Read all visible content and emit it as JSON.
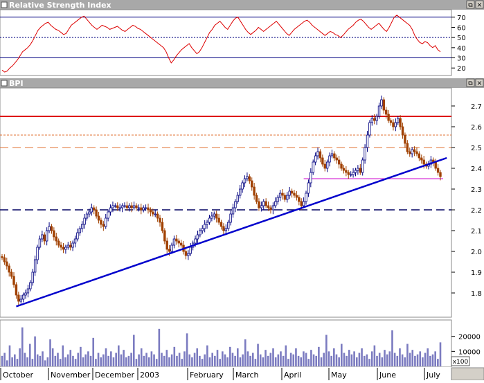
{
  "rsi_panel": {
    "title": "Relative Strength Index",
    "ticks": [
      70,
      60,
      50,
      40,
      30,
      20
    ],
    "levels": {
      "upper": 70,
      "mid": 50,
      "lower": 30
    },
    "ylim": [
      14,
      76
    ]
  },
  "price_panel": {
    "title": "BPI",
    "ticks": [
      2.7,
      2.6,
      2.5,
      2.4,
      2.3,
      2.2,
      2.1,
      2.0,
      1.9,
      1.8
    ],
    "tick_labels": [
      "2.7",
      "2.6",
      "2.5",
      "2.4",
      "2.3",
      "2.2",
      "2.1",
      "2.0",
      "1.9",
      "1.8"
    ],
    "ylim": [
      1.69,
      2.78
    ],
    "hlines": [
      {
        "name": "resistance-red",
        "value": 2.65,
        "color": "#dd0000",
        "style": "solid"
      },
      {
        "name": "fib-dotted",
        "value": 2.56,
        "color": "#e07030",
        "style": "dotted"
      },
      {
        "name": "fib-dashed",
        "value": 2.5,
        "color": "#e07030",
        "style": "dashed"
      },
      {
        "name": "support-magenta",
        "value": 2.35,
        "color": "#cc00cc",
        "style": "solid-short"
      },
      {
        "name": "support-navy-dashed",
        "value": 2.2,
        "color": "#000060",
        "style": "dashed"
      }
    ],
    "trendline": {
      "from": {
        "bar": 6,
        "value": 1.735
      },
      "to": {
        "bar": 184,
        "value": 2.45
      },
      "color": "#0000cc"
    }
  },
  "volume_panel": {
    "ticks": [
      20000,
      10000
    ],
    "ylim": [
      0,
      30000
    ],
    "multiplier_label": "x100"
  },
  "x_axis": {
    "labels": [
      "October",
      "November",
      "December",
      "2003",
      "February",
      "March",
      "April",
      "May",
      "June",
      "July"
    ]
  },
  "colors": {
    "up": "#000080",
    "down": "#a04000",
    "rsi": "#dd0000",
    "volume": "#7b7bc0",
    "header": "#999999"
  },
  "window_buttons": {
    "restore": "⧉",
    "close": "×"
  },
  "chart_data": {
    "type": "candlestick",
    "title": "BPI",
    "x_labels": [
      "October",
      "November",
      "December",
      "2003",
      "February",
      "March",
      "April",
      "May",
      "June",
      "July"
    ],
    "series": [
      {
        "name": "price_close",
        "values": [
          1.97,
          1.95,
          1.93,
          1.9,
          1.88,
          1.84,
          1.79,
          1.76,
          1.77,
          1.79,
          1.8,
          1.82,
          1.85,
          1.9,
          1.96,
          2.02,
          2.06,
          2.08,
          2.05,
          2.1,
          2.12,
          2.1,
          2.07,
          2.05,
          2.03,
          2.02,
          2.01,
          2.02,
          2.03,
          2.02,
          2.04,
          2.06,
          2.09,
          2.11,
          2.13,
          2.16,
          2.18,
          2.19,
          2.21,
          2.2,
          2.17,
          2.15,
          2.13,
          2.12,
          2.16,
          2.19,
          2.21,
          2.22,
          2.22,
          2.21,
          2.21,
          2.22,
          2.22,
          2.21,
          2.22,
          2.21,
          2.22,
          2.21,
          2.21,
          2.2,
          2.21,
          2.21,
          2.2,
          2.19,
          2.18,
          2.18,
          2.16,
          2.14,
          2.1,
          2.05,
          2.01,
          2.0,
          2.03,
          2.06,
          2.05,
          2.04,
          2.03,
          2.0,
          1.98,
          1.99,
          2.02,
          2.04,
          2.06,
          2.08,
          2.1,
          2.11,
          2.13,
          2.14,
          2.16,
          2.17,
          2.18,
          2.16,
          2.14,
          2.12,
          2.1,
          2.11,
          2.14,
          2.18,
          2.21,
          2.24,
          2.27,
          2.3,
          2.33,
          2.35,
          2.36,
          2.34,
          2.31,
          2.27,
          2.24,
          2.21,
          2.22,
          2.24,
          2.22,
          2.21,
          2.2,
          2.22,
          2.24,
          2.26,
          2.28,
          2.27,
          2.25,
          2.27,
          2.29,
          2.28,
          2.27,
          2.26,
          2.24,
          2.22,
          2.24,
          2.28,
          2.33,
          2.38,
          2.43,
          2.46,
          2.48,
          2.45,
          2.42,
          2.4,
          2.43,
          2.46,
          2.47,
          2.45,
          2.44,
          2.42,
          2.4,
          2.39,
          2.38,
          2.37,
          2.37,
          2.38,
          2.39,
          2.4,
          2.38,
          2.44,
          2.5,
          2.56,
          2.62,
          2.64,
          2.63,
          2.65,
          2.7,
          2.73,
          2.68,
          2.66,
          2.63,
          2.62,
          2.6,
          2.62,
          2.64,
          2.6,
          2.56,
          2.52,
          2.48,
          2.47,
          2.49,
          2.48,
          2.47,
          2.45,
          2.44,
          2.42,
          2.41,
          2.42,
          2.44,
          2.43,
          2.4,
          2.38,
          2.36
        ]
      },
      {
        "name": "rsi",
        "values": [
          18,
          16,
          17,
          20,
          22,
          25,
          28,
          32,
          36,
          38,
          40,
          43,
          47,
          52,
          57,
          60,
          62,
          64,
          65,
          62,
          60,
          58,
          57,
          55,
          53,
          54,
          58,
          62,
          64,
          66,
          68,
          70,
          71,
          68,
          65,
          62,
          60,
          58,
          60,
          62,
          61,
          60,
          58,
          59,
          60,
          61,
          59,
          57,
          56,
          58,
          60,
          62,
          61,
          59,
          58,
          56,
          54,
          52,
          50,
          48,
          46,
          44,
          42,
          40,
          36,
          30,
          25,
          28,
          32,
          35,
          38,
          40,
          42,
          44,
          40,
          37,
          34,
          36,
          40,
          45,
          50,
          55,
          58,
          62,
          64,
          66,
          63,
          60,
          58,
          62,
          66,
          69,
          70,
          66,
          62,
          58,
          55,
          53,
          55,
          57,
          60,
          58,
          56,
          58,
          60,
          62,
          64,
          66,
          63,
          60,
          57,
          54,
          52,
          55,
          58,
          60,
          62,
          64,
          66,
          67,
          65,
          62,
          60,
          58,
          56,
          54,
          52,
          54,
          56,
          55,
          53,
          52,
          50,
          52,
          55,
          58,
          60,
          62,
          65,
          67,
          68,
          66,
          63,
          60,
          58,
          60,
          62,
          64,
          61,
          58,
          56,
          60,
          65,
          70,
          72,
          70,
          68,
          66,
          64,
          62,
          58,
          52,
          48,
          45,
          44,
          46,
          45,
          42,
          40,
          42,
          38,
          36
        ]
      },
      {
        "name": "volume",
        "values": [
          7000,
          9000,
          4000,
          14000,
          6000,
          8000,
          5000,
          12000,
          26000,
          9000,
          6000,
          15000,
          5000,
          20000,
          8000,
          7000,
          10000,
          4000,
          6000,
          18000,
          12000,
          7000,
          9000,
          5000,
          14000,
          6000,
          8000,
          11000,
          7000,
          5000,
          9000,
          13000,
          6000,
          8000,
          10000,
          7000,
          19000,
          5000,
          9000,
          6000,
          8000,
          12000,
          7000,
          10000,
          6000,
          9000,
          14000,
          8000,
          11000,
          6000,
          7000,
          9000,
          21000,
          5000,
          8000,
          12000,
          7000,
          9000,
          6000,
          10000,
          8000,
          5000,
          25000,
          9000,
          7000,
          11000,
          6000,
          8000,
          13000,
          7000,
          9000,
          5000,
          10000,
          22000,
          8000,
          6000,
          9000,
          12000,
          7000,
          5000,
          8000,
          14000,
          6000,
          9000,
          7000,
          11000,
          5000,
          10000,
          8000,
          6000,
          13000,
          9000,
          7000,
          12000,
          6000,
          8000,
          18000,
          10000,
          7000,
          9000,
          5000,
          15000,
          8000,
          6000,
          11000,
          7000,
          9000,
          12000,
          6000,
          8000,
          10000,
          7000,
          14000,
          5000,
          9000,
          8000,
          12000,
          7000,
          6000,
          10000,
          9000,
          5000,
          11000,
          8000,
          7000,
          13000,
          6000,
          9000,
          21000,
          10000,
          7000,
          12000,
          8000,
          6000,
          15000,
          9000,
          7000,
          11000,
          8000,
          10000,
          6000,
          9000,
          12000,
          7000,
          8000,
          5000,
          10000,
          14000,
          7000,
          9000,
          6000,
          11000,
          8000,
          10000,
          24000,
          9000,
          7000,
          12000,
          8000,
          6000,
          15000,
          9000,
          11000,
          7000,
          8000,
          10000,
          6000,
          9000,
          12000,
          7000,
          8000,
          10000,
          5000,
          16000
        ]
      }
    ],
    "ylim_price": [
      1.69,
      2.78
    ],
    "ylim_rsi": [
      14,
      76
    ],
    "ylim_volume": [
      0,
      30000
    ]
  }
}
